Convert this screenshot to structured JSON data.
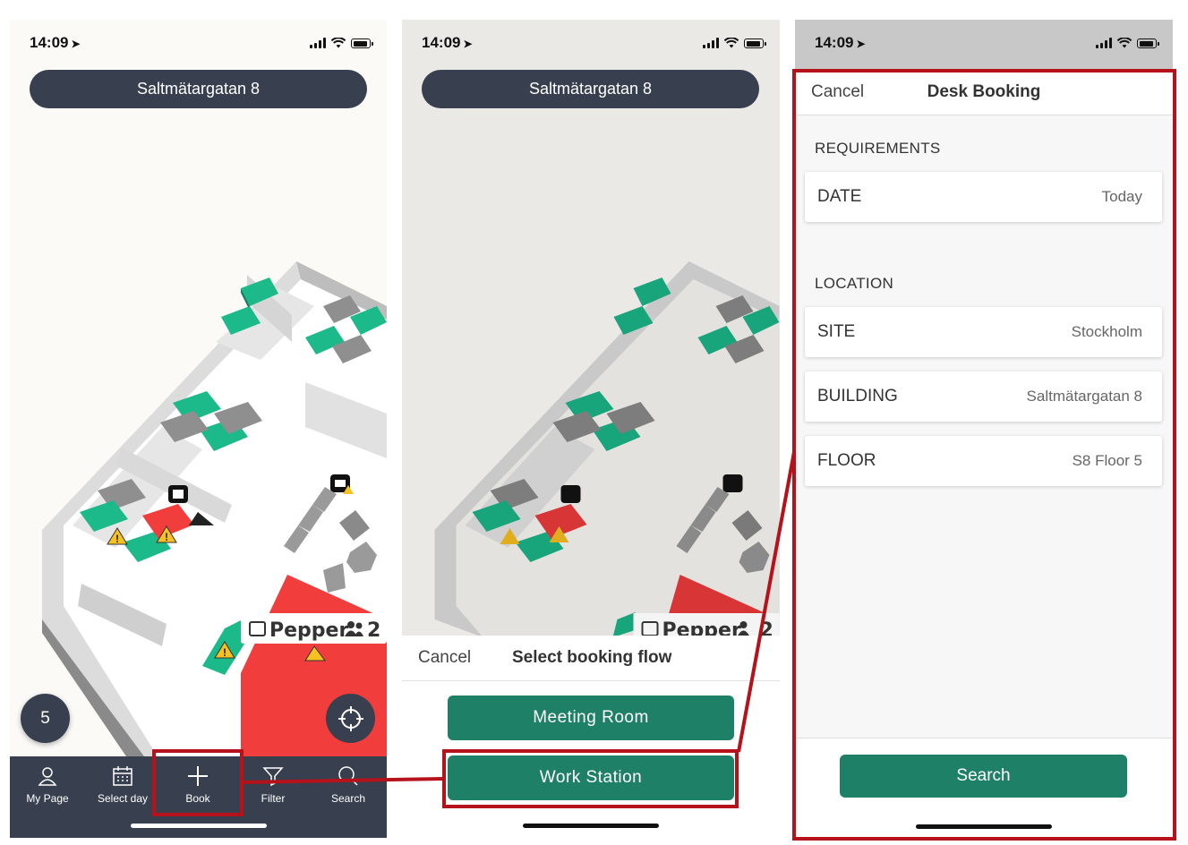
{
  "status": {
    "time": "14:09"
  },
  "screen1": {
    "address": "Saltmätargatan 8",
    "map_label": {
      "name": "Pepper",
      "count": "2"
    },
    "desk_count": "5",
    "tabs": [
      {
        "label": "My Page",
        "icon": "person-icon"
      },
      {
        "label": "Select day",
        "icon": "calendar-icon"
      },
      {
        "label": "Book",
        "icon": "plus-icon"
      },
      {
        "label": "Filter",
        "icon": "filter-icon"
      },
      {
        "label": "Search",
        "icon": "search-icon"
      }
    ]
  },
  "screen2": {
    "address": "Saltmätargatan 8",
    "map_label": {
      "name": "Pepper",
      "count": "2"
    },
    "sheet": {
      "cancel": "Cancel",
      "title": "Select booking flow",
      "options": [
        "Meeting Room",
        "Work Station"
      ]
    }
  },
  "screen3": {
    "cancel": "Cancel",
    "title": "Desk Booking",
    "sections": {
      "requirements": "REQUIREMENTS",
      "location": "LOCATION"
    },
    "fields": {
      "date": {
        "label": "DATE",
        "value": "Today"
      },
      "site": {
        "label": "SITE",
        "value": "Stockholm"
      },
      "building": {
        "label": "BUILDING",
        "value": "Saltmätargatan 8"
      },
      "floor": {
        "label": "FLOOR",
        "value": "S8 Floor 5"
      }
    },
    "search_button": "Search"
  },
  "colors": {
    "navy": "#383f4e",
    "green": "#1f8068",
    "desk_free": "#15b482",
    "desk_busy": "#f23d3d",
    "highlight": "#b5121b"
  }
}
